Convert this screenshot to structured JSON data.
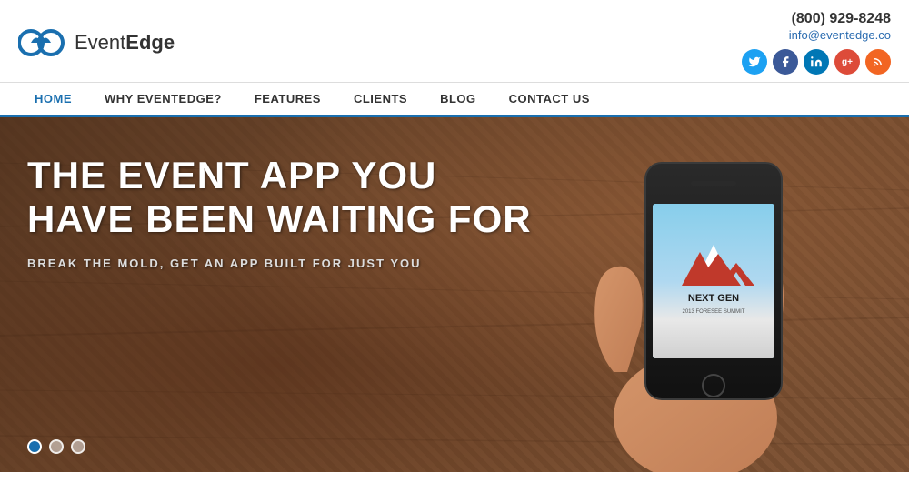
{
  "header": {
    "logo_text_light": "Event",
    "logo_text_bold": "Edge",
    "phone": "(800) 929-8248",
    "email": "info@eventedge.co"
  },
  "social": [
    {
      "name": "twitter",
      "color": "#1da1f2",
      "symbol": "t"
    },
    {
      "name": "facebook",
      "color": "#3b5998",
      "symbol": "f"
    },
    {
      "name": "linkedin",
      "color": "#0077b5",
      "symbol": "in"
    },
    {
      "name": "google-plus",
      "color": "#dd4b39",
      "symbol": "g+"
    },
    {
      "name": "rss",
      "color": "#f26522",
      "symbol": "rss"
    }
  ],
  "nav": {
    "items": [
      {
        "label": "HOME",
        "active": true
      },
      {
        "label": "WHY EVENTEDGE?",
        "active": false
      },
      {
        "label": "FEATURES",
        "active": false
      },
      {
        "label": "CLIENTS",
        "active": false
      },
      {
        "label": "BLOG",
        "active": false
      },
      {
        "label": "CONTACT US",
        "active": false
      }
    ]
  },
  "hero": {
    "title_line1": "THE EVENT APP YOU",
    "title_line2": "HAVE BEEN WAITING FOR",
    "subtitle": "BREAK THE MOLD, GET AN APP BUILT FOR JUST YOU",
    "screen_brand": "NEXT GEN",
    "screen_subbrand": "2013 FORESEE SUMMIT"
  },
  "dots": [
    {
      "active": true
    },
    {
      "active": false
    },
    {
      "active": false
    }
  ]
}
